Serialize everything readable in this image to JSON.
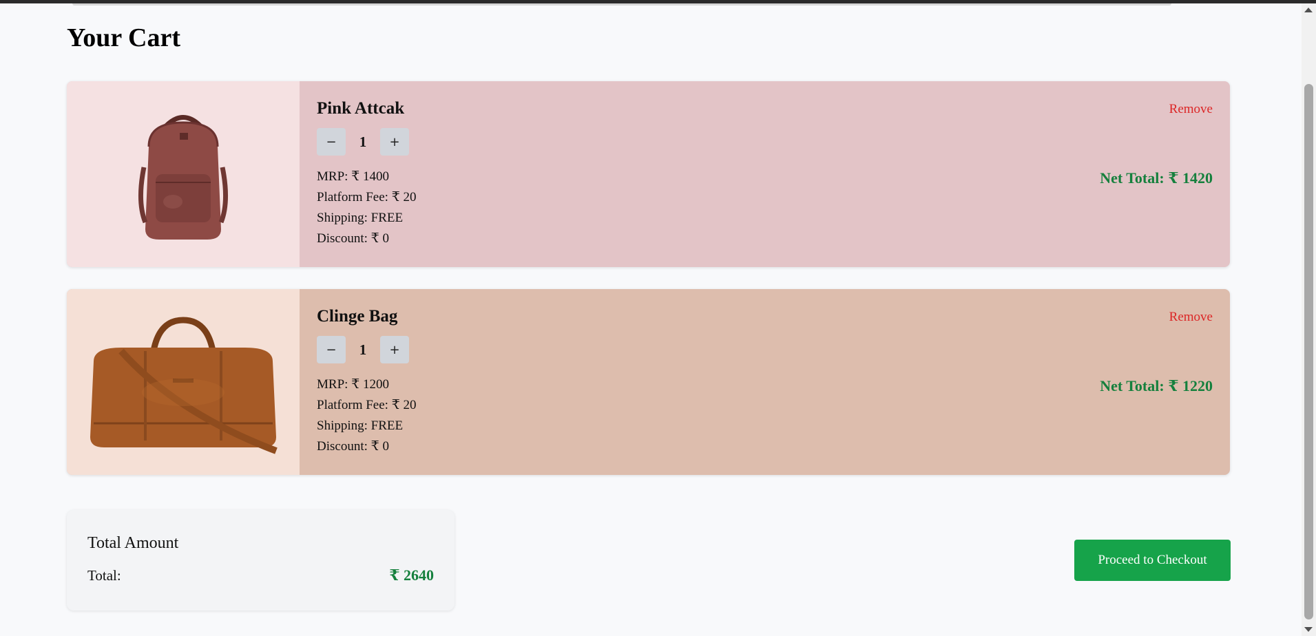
{
  "page": {
    "title": "Your Cart"
  },
  "colors": {
    "accent_green": "#16a34a",
    "total_green": "#15803d",
    "remove_red": "#dc2626"
  },
  "items": [
    {
      "name": "Pink Attcak",
      "image": "pink-leather-backpack",
      "quantity": "1",
      "decrease_label": "−",
      "increase_label": "+",
      "mrp": "MRP: ₹ 1400",
      "platform_fee": "Platform Fee: ₹ 20",
      "shipping": "Shipping: FREE",
      "discount": "Discount: ₹ 0",
      "remove_label": "Remove",
      "net_total": "Net Total: ₹ 1420",
      "card_color": "#e3c4c7",
      "image_bg": "#f5e1e2"
    },
    {
      "name": "Clinge Bag",
      "image": "brown-leather-duffel-bag",
      "quantity": "1",
      "decrease_label": "−",
      "increase_label": "+",
      "mrp": "MRP: ₹ 1200",
      "platform_fee": "Platform Fee: ₹ 20",
      "shipping": "Shipping: FREE",
      "discount": "Discount: ₹ 0",
      "remove_label": "Remove",
      "net_total": "Net Total: ₹ 1220",
      "card_color": "#ddbdad",
      "image_bg": "#f5e0d6"
    }
  ],
  "summary": {
    "heading": "Total Amount",
    "total_label": "Total:",
    "total_value": "₹ 2640"
  },
  "checkout": {
    "label": "Proceed to Checkout"
  }
}
